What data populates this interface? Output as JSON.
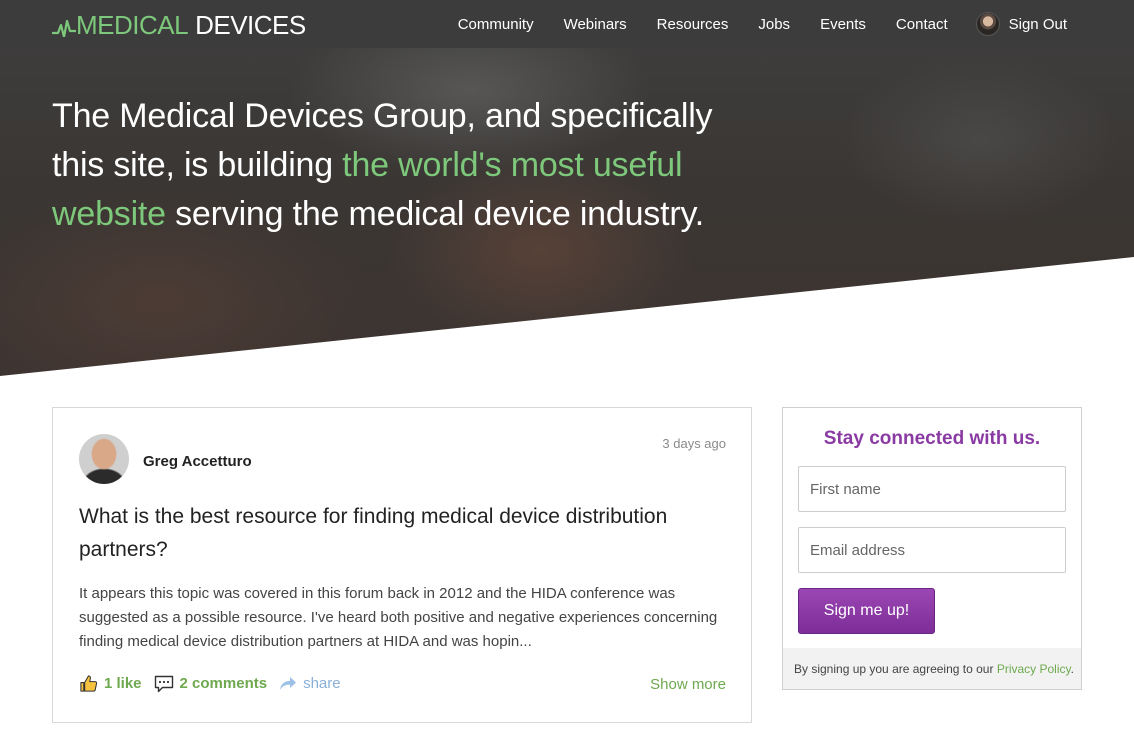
{
  "brand": {
    "medical": "MEDICAL",
    "devices": "DEVICES",
    "accent": "#7dc87b"
  },
  "nav": {
    "items": [
      "Community",
      "Webinars",
      "Resources",
      "Jobs",
      "Events",
      "Contact"
    ],
    "signout": "Sign Out"
  },
  "hero": {
    "line_pre": "The Medical Devices Group, and specifically this site, is building ",
    "highlight": "the world's most useful website",
    "line_post": " serving the medical device industry."
  },
  "post": {
    "author": "Greg Accetturo",
    "time": "3 days ago",
    "title": "What is the best resource for finding medical device distribution partners?",
    "excerpt": "It appears this topic was covered in this forum back in 2012 and the HIDA conference was suggested as a possible resource. I've heard both positive and negative experiences concerning finding medical device distribution partners at HIDA and was hopin...",
    "likes": "1 like",
    "comments": "2 comments",
    "share": "share",
    "show_more": "Show more"
  },
  "signup": {
    "title": "Stay connected with us.",
    "first_placeholder": "First name",
    "email_placeholder": "Email address",
    "button": "Sign me up!",
    "notice": "By signing up you are agreeing to our ",
    "privacy": "Privacy Policy",
    "period": ".",
    "accent": "#8a3aa3"
  },
  "icons": {
    "logo": "heartbeat-line-icon",
    "like": "thumbs-up-icon",
    "comments": "comment-bubble-icon",
    "share": "share-arrow-icon"
  }
}
